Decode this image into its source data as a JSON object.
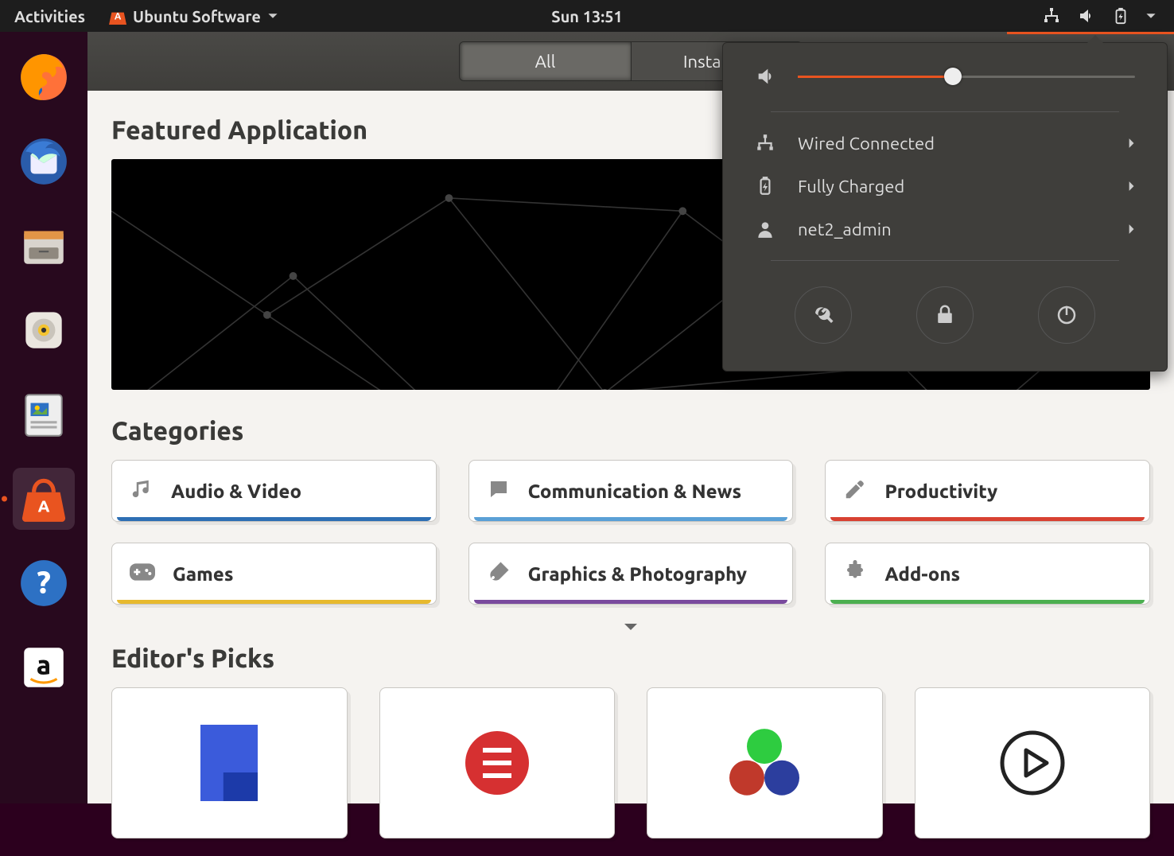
{
  "topbar": {
    "activities": "Activities",
    "app_name": "Ubuntu Software",
    "clock": "Sun 13:51"
  },
  "toolbar": {
    "tabs": [
      "All",
      "Installed"
    ],
    "active_index": 0
  },
  "sections": {
    "featured_title": "Featured Application",
    "categories_title": "Categories",
    "editors_picks_title": "Editor's Picks"
  },
  "categories": [
    {
      "label": "Audio & Video",
      "icon": "music",
      "color": "#2e6fb4"
    },
    {
      "label": "Communication & News",
      "icon": "chat",
      "color": "#5aa0d6"
    },
    {
      "label": "Productivity",
      "icon": "edit",
      "color": "#d84132"
    },
    {
      "label": "Games",
      "icon": "gamepad",
      "color": "#e7b92e"
    },
    {
      "label": "Graphics & Photography",
      "icon": "brush",
      "color": "#7a4a9e"
    },
    {
      "label": "Add-ons",
      "icon": "puzzle",
      "color": "#4caf50"
    }
  ],
  "system_menu": {
    "volume_percent": 46,
    "items": [
      {
        "label": "Wired Connected",
        "icon": "network"
      },
      {
        "label": "Fully Charged",
        "icon": "battery"
      },
      {
        "label": "net2_admin",
        "icon": "user"
      }
    ],
    "actions": [
      "settings",
      "lock",
      "power"
    ]
  },
  "dock": {
    "items": [
      "firefox",
      "thunderbird",
      "files",
      "rhythmbox",
      "writer",
      "software",
      "help",
      "amazon"
    ],
    "active": "software"
  }
}
